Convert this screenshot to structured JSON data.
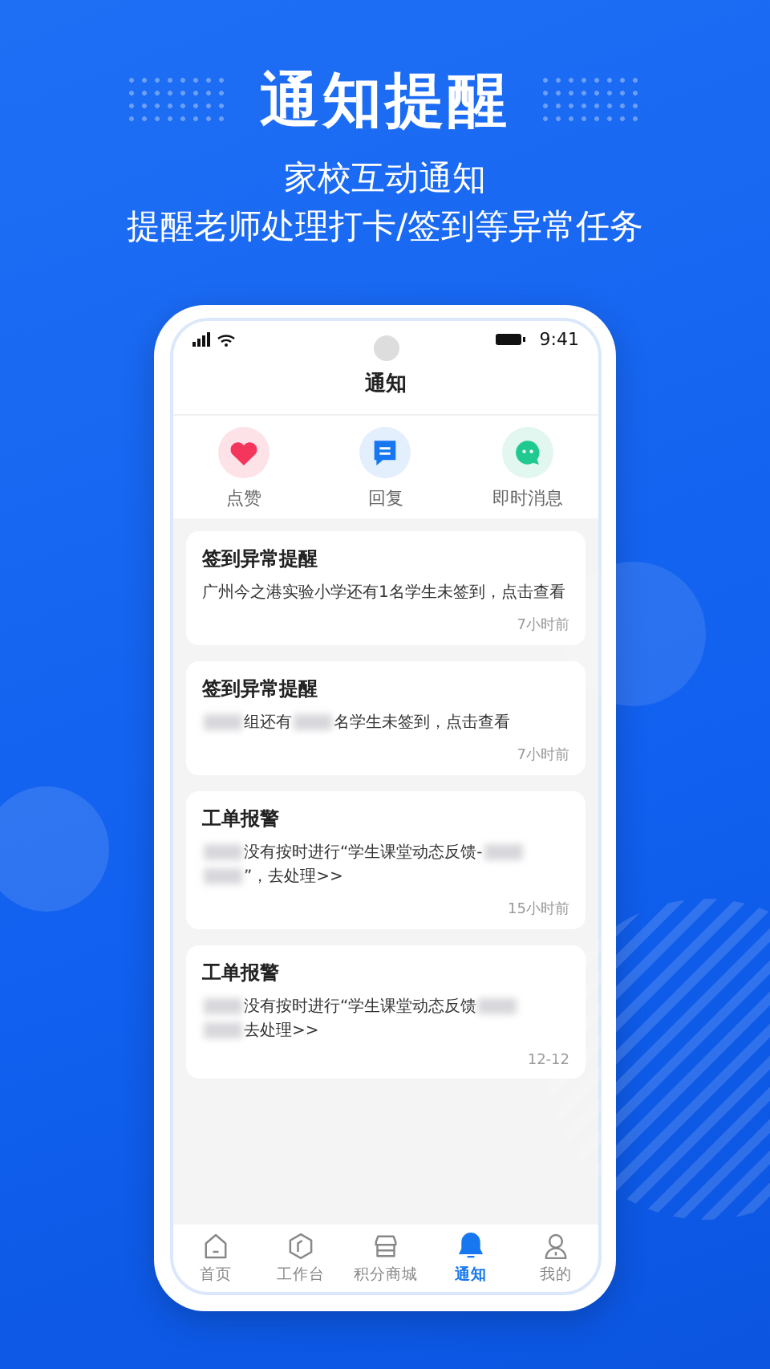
{
  "banner": {
    "title": "通知提醒",
    "subtitle_lines": [
      "家校互动通知",
      "提醒老师处理打卡/签到等异常任务"
    ]
  },
  "status_bar": {
    "time": "9:41"
  },
  "header": {
    "title": "通知"
  },
  "quick_actions": [
    {
      "kind": "heart",
      "label": "点赞"
    },
    {
      "kind": "reply",
      "label": "回复"
    },
    {
      "kind": "chat",
      "label": "即时消息"
    }
  ],
  "notifications": [
    {
      "title": "签到异常提醒",
      "message": [
        {
          "kind": "text",
          "text": "广州今之港实验小学还有1名学生未签到，点击查看"
        }
      ],
      "time": "7小时前"
    },
    {
      "title": "签到异常提醒",
      "message": [
        {
          "kind": "redacted"
        },
        {
          "kind": "text",
          "text": "组还有"
        },
        {
          "kind": "redacted"
        },
        {
          "kind": "text",
          "text": "名学生未签到，点击查看"
        }
      ],
      "time": "7小时前"
    },
    {
      "title": "工单报警",
      "message": [
        {
          "kind": "redacted"
        },
        {
          "kind": "text",
          "text": "没有按时进行“学生课堂动态反馈-"
        },
        {
          "kind": "redacted"
        },
        {
          "kind": "break"
        },
        {
          "kind": "redacted"
        },
        {
          "kind": "text",
          "text": "”，去处理>>"
        }
      ],
      "time": "15小时前"
    },
    {
      "title": "工单报警",
      "message": [
        {
          "kind": "redacted"
        },
        {
          "kind": "text",
          "text": "没有按时进行“学生课堂动态反馈"
        },
        {
          "kind": "redacted"
        },
        {
          "kind": "break"
        },
        {
          "kind": "redacted"
        },
        {
          "kind": "text",
          "text": "去处理>>"
        }
      ],
      "time": "12-12"
    }
  ],
  "tab_bar": [
    {
      "kind": "home",
      "label": "首页",
      "selected": false
    },
    {
      "kind": "workbench",
      "label": "工作台",
      "selected": false
    },
    {
      "kind": "shop",
      "label": "积分商城",
      "selected": false
    },
    {
      "kind": "bell",
      "label": "通知",
      "selected": true
    },
    {
      "kind": "user",
      "label": "我的",
      "selected": false
    }
  ]
}
